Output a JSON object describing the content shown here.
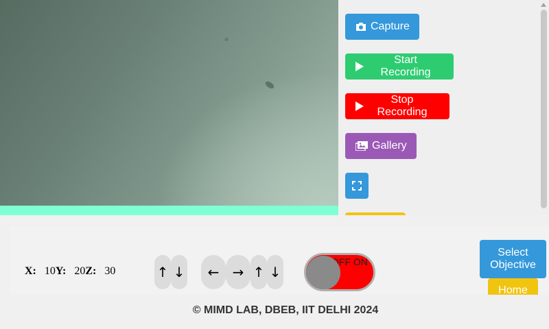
{
  "sidebar": {
    "capture_label": "Capture",
    "start_recording_label": "Start Recording",
    "stop_recording_label": "Stop Recording",
    "gallery_label": "Gallery",
    "fullscreen_icon": "fullscreen-icon"
  },
  "coordinates": {
    "x_label": "X:",
    "x_value": "10",
    "y_label": "Y:",
    "y_value": "20",
    "z_label": "Z:",
    "z_value": "30"
  },
  "controls": {
    "z_up": "↑",
    "z_down": "↓",
    "left": "←",
    "right": "→",
    "up": "↑",
    "down": "↓",
    "toggle_text": "OFF ON"
  },
  "objective": {
    "select_label": "Select Objective",
    "home_label": "Home"
  },
  "footer": {
    "text": "© MIMD LAB, DBEB, IIT DELHI 2024"
  },
  "colors": {
    "capture": "#3498db",
    "start": "#2ecc71",
    "stop": "#ff0000",
    "gallery": "#9b59b6",
    "home": "#f1c40f",
    "preview_bar": "#7fffd4"
  }
}
